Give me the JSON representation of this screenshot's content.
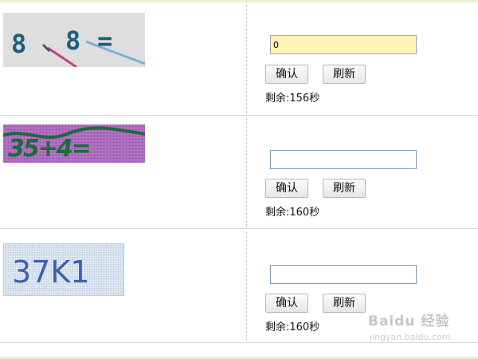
{
  "rows": [
    {
      "captcha_text": "8 \\ 8 =",
      "answer_value": "0",
      "confirm_label": "确认",
      "refresh_label": "刷新",
      "timer_text": "剩余:156秒"
    },
    {
      "captcha_text": "35+4=",
      "answer_value": "",
      "confirm_label": "确认",
      "refresh_label": "刷新",
      "timer_text": "剩余:160秒"
    },
    {
      "captcha_text": "37K1",
      "answer_value": "",
      "confirm_label": "确认",
      "refresh_label": "刷新",
      "timer_text": "剩余:160秒"
    }
  ],
  "watermark": {
    "brand": "Baidu 经验",
    "url": "jingyan.baidu.com"
  },
  "colors": {
    "active_input_bg": "#fff3b8",
    "captcha1_bg": "#dedede",
    "captcha2_bg": "#ad6bbf",
    "captcha3_bg": "#d6e2ee"
  }
}
